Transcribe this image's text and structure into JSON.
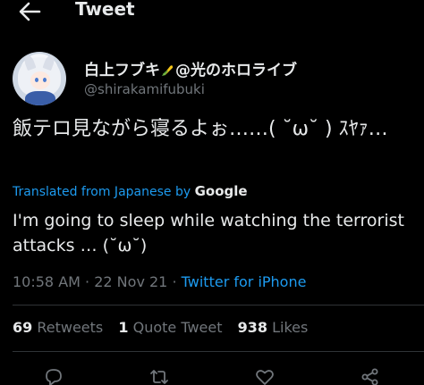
{
  "header": {
    "title": "Tweet",
    "back_icon": "arrow-left-icon"
  },
  "author": {
    "display_name_prefix": "白上フブキ",
    "display_name_icon": "corn-emoji-icon",
    "display_name_suffix": "@光のホロライブ",
    "handle": "@shirakamifubuki"
  },
  "tweet": {
    "text": "飯テロ見ながら寝るよぉ……( ˘ω˘ ) ｽﾔｧ…",
    "translated_label": "Translated from Japanese by",
    "translator": "Google",
    "translation": "I'm going to sleep while watching the terrorist attacks … (˘ω˘)"
  },
  "meta": {
    "time": "10:58 AM",
    "date": "22 Nov 21",
    "separator": "·",
    "source": "Twitter for iPhone"
  },
  "stats": {
    "retweets_count": "69",
    "retweets_label": "Retweets",
    "quotes_count": "1",
    "quotes_label": "Quote Tweet",
    "likes_count": "938",
    "likes_label": "Likes"
  },
  "actions": [
    "reply-icon",
    "retweet-icon",
    "like-icon",
    "share-icon"
  ],
  "colors": {
    "background": "#000000",
    "text": "#e7e9ea",
    "muted": "#71767b",
    "link": "#1d9bf0",
    "divider": "#2f3336"
  }
}
